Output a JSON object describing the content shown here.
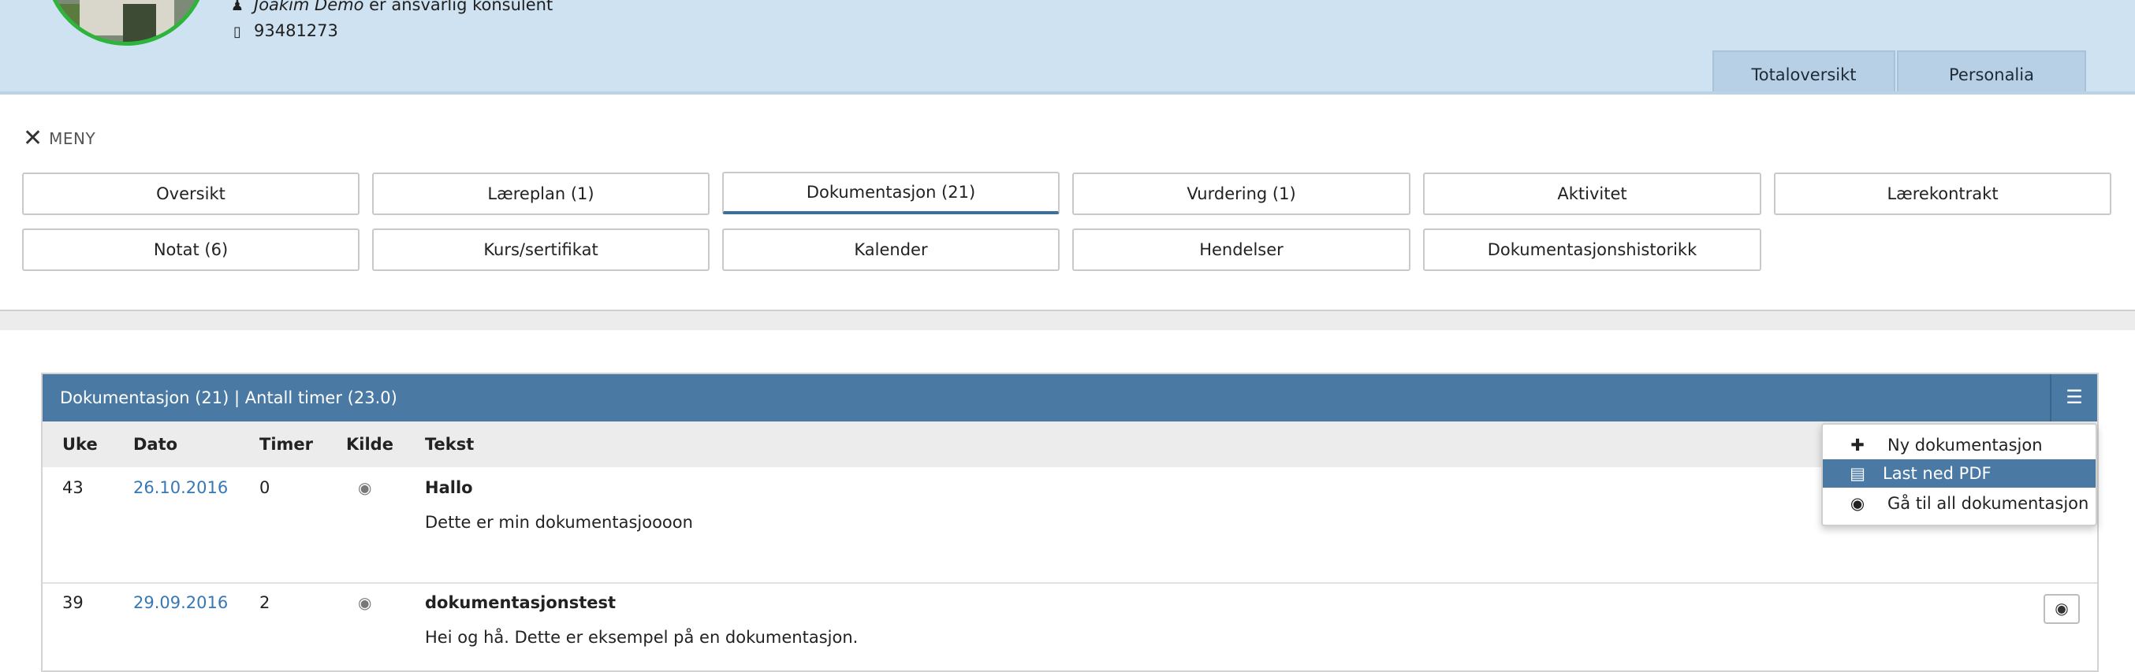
{
  "header": {
    "consultant_name": "Joakim Demo",
    "consultant_suffix": "er ansvarlig konsulent",
    "phone": "93481273",
    "tabs": [
      {
        "label": "Totaloversikt"
      },
      {
        "label": "Personalia"
      }
    ]
  },
  "menu": {
    "toggle_label": "MENY",
    "items": [
      {
        "label": "Oversikt"
      },
      {
        "label": "Læreplan (1)"
      },
      {
        "label": "Dokumentasjon (21)"
      },
      {
        "label": "Vurdering (1)"
      },
      {
        "label": "Aktivitet"
      },
      {
        "label": "Lærekontrakt"
      },
      {
        "label": "Notat (6)"
      },
      {
        "label": "Kurs/sertifikat"
      },
      {
        "label": "Kalender"
      },
      {
        "label": "Hendelser"
      },
      {
        "label": "Dokumentasjonshistorikk"
      }
    ],
    "active": "Dokumentasjon (21)"
  },
  "panel": {
    "title": "Dokumentasjon (21) | Antall timer (23.0)",
    "columns": [
      "Uke",
      "Dato",
      "Timer",
      "Kilde",
      "Tekst"
    ],
    "rows": [
      {
        "uke": "43",
        "dato": "26.10.2016",
        "timer": "0",
        "title": "Hallo",
        "text": "Dette er min dokumentasjoooon"
      },
      {
        "uke": "39",
        "dato": "29.09.2016",
        "timer": "2",
        "title": "dokumentasjonstest",
        "text": "Hei og hå. Dette er eksempel på en dokumentasjon."
      }
    ]
  },
  "dropdown": {
    "items": [
      {
        "label": "Ny dokumentasjon",
        "icon": "plus-icon"
      },
      {
        "label": "Last ned PDF",
        "icon": "pdf-file-icon"
      },
      {
        "label": "Gå til all dokumentasjon",
        "icon": "eye-icon"
      }
    ],
    "highlighted": "Last ned PDF"
  },
  "colors": {
    "header_bg": "#cfe2f1",
    "panel_header": "#4a7aa3",
    "link": "#3578b5",
    "avatar_ring": "#2db53b"
  }
}
